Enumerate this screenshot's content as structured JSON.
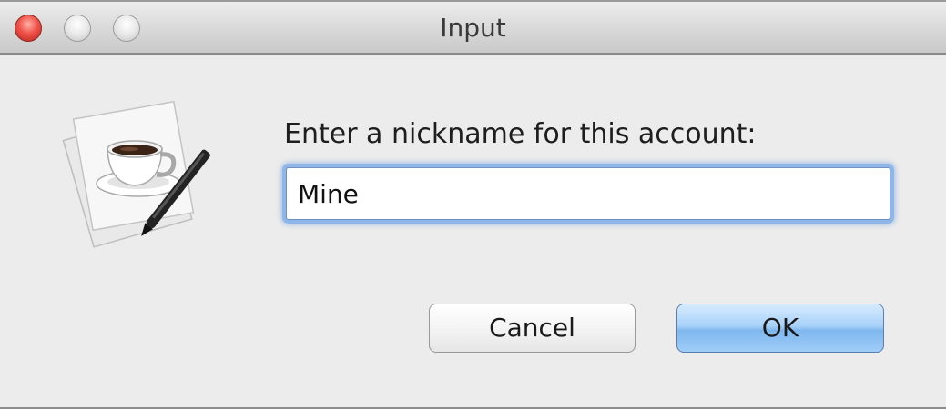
{
  "window": {
    "title": "Input"
  },
  "titlebar_buttons": {
    "close_icon": "close-icon",
    "minimize_icon": "minimize-icon",
    "zoom_icon": "zoom-icon"
  },
  "dialog": {
    "icon": "java-coffee-document-icon",
    "prompt": "Enter a nickname for this account:",
    "input_value": "Mine",
    "cancel_label": "Cancel",
    "ok_label": "OK"
  },
  "colors": {
    "close": "#f0524a",
    "focus_ring": "#8fb6e8",
    "default_button": "#9fcdf8"
  }
}
